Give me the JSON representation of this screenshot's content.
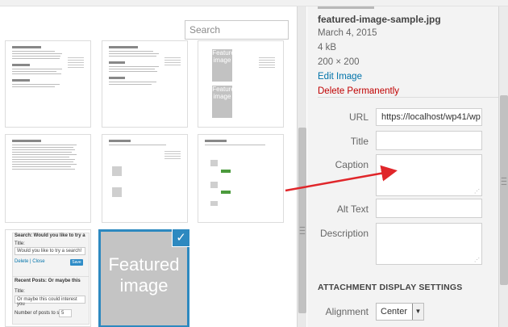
{
  "search": {
    "placeholder": "Search"
  },
  "library": {
    "featured_image_text": "Featured image",
    "selected_check": "✓"
  },
  "details": {
    "filename": "featured-image-sample.jpg",
    "date": "March 4, 2015",
    "size": "4 kB",
    "dimensions": "200 × 200",
    "edit_link": "Edit Image",
    "delete_link": "Delete Permanently"
  },
  "fields": {
    "url": {
      "label": "URL",
      "value": "https://localhost/wp41/wp"
    },
    "title": {
      "label": "Title",
      "value": ""
    },
    "caption": {
      "label": "Caption",
      "value": ""
    },
    "alt": {
      "label": "Alt Text",
      "value": ""
    },
    "description": {
      "label": "Description",
      "value": ""
    }
  },
  "display_settings": {
    "heading": "ATTACHMENT DISPLAY SETTINGS",
    "alignment_label": "Alignment",
    "alignment_value": "Center"
  },
  "thumb_text": {
    "widget_search_header": "Search: Would you like to try a",
    "widget_title_label": "Title:",
    "widget_search_value": "Would you like to try a search!",
    "widget_delete": "Delete",
    "widget_sep": "|",
    "widget_close": "Close",
    "widget_save": "Save",
    "widget_recent_header": "Recent Posts: Or maybe this",
    "widget_title_label2": "Title:",
    "widget_recent_value": "Or maybe this could interest you",
    "widget_number_label": "Number of posts to show:",
    "widget_number_value": "5",
    "mini_featured_a": "Featured image",
    "mini_featured_b": "Featured image"
  },
  "colors": {
    "accent": "#2d89c0",
    "link": "#0073aa",
    "danger": "#c00000",
    "arrow": "#e0262a"
  }
}
